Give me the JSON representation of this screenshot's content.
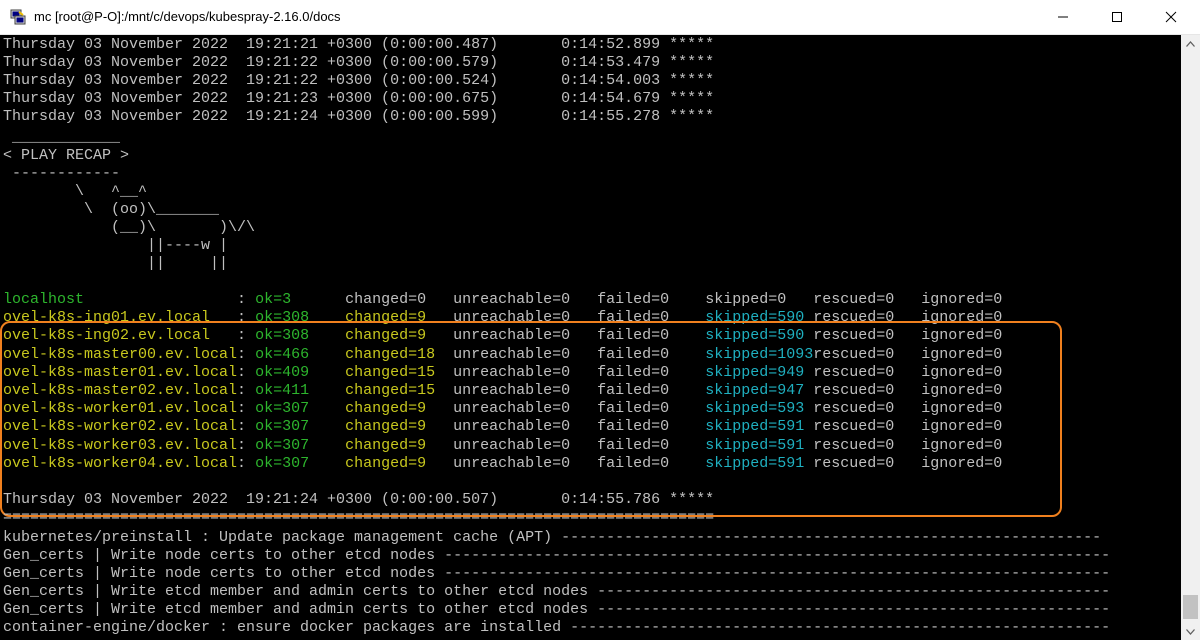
{
  "window": {
    "title": "mc [root@P-O]:/mnt/c/devops/kubespray-2.16.0/docs",
    "app_icon": "putty-terminal-icon",
    "buttons": {
      "minimize": "minimize-icon",
      "maximize": "maximize-icon",
      "close": "close-icon"
    }
  },
  "colors": {
    "background": "#000000",
    "text": "#c0c0c0",
    "ok": "#2db52d",
    "changed": "#c8c81e",
    "skipped": "#1fb0c0",
    "highlight": "#f0801e"
  },
  "terminal": {
    "timing_lines": [
      "Thursday 03 November 2022  19:21:21 +0300 (0:00:00.487)       0:14:52.899 *****",
      "Thursday 03 November 2022  19:21:22 +0300 (0:00:00.579)       0:14:53.479 *****",
      "Thursday 03 November 2022  19:21:22 +0300 (0:00:00.524)       0:14:54.003 *****",
      "Thursday 03 November 2022  19:21:23 +0300 (0:00:00.675)       0:14:54.679 *****",
      "Thursday 03 November 2022  19:21:24 +0300 (0:00:00.599)       0:14:55.278 *****"
    ],
    "cowsay": [
      " ____________",
      "< PLAY RECAP >",
      " ------------",
      "        \\   ^__^",
      "         \\  (oo)\\_______",
      "            (__)\\       )\\/\\",
      "                ||----w |",
      "                ||     ||"
    ],
    "recap": [
      {
        "host": "localhost                 ",
        "sep": ": ",
        "ok": "ok=3  ",
        "changed": "changed=0 ",
        "unreachable": "unreachable=0   ",
        "failed": "failed=0    ",
        "skipped": "skipped=0   ",
        "rescued": "rescued=0   ",
        "ignored": "ignored=0",
        "c_host": "c-green",
        "c_ok": "c-green",
        "c_changed": "c-gray",
        "c_skipped": "c-gray"
      },
      {
        "host": "ovel-k8s-ing01.ev.local   ",
        "sep": ": ",
        "ok": "ok=308",
        "changed": "changed=9 ",
        "unreachable": "unreachable=0   ",
        "failed": "failed=0    ",
        "skipped": "skipped=590 ",
        "rescued": "rescued=0   ",
        "ignored": "ignored=0",
        "c_host": "c-yellow",
        "c_ok": "c-green",
        "c_changed": "c-yellow",
        "c_skipped": "c-cyan"
      },
      {
        "host": "ovel-k8s-ing02.ev.local   ",
        "sep": ": ",
        "ok": "ok=308",
        "changed": "changed=9 ",
        "unreachable": "unreachable=0   ",
        "failed": "failed=0    ",
        "skipped": "skipped=590 ",
        "rescued": "rescued=0   ",
        "ignored": "ignored=0",
        "c_host": "c-yellow",
        "c_ok": "c-green",
        "c_changed": "c-yellow",
        "c_skipped": "c-cyan"
      },
      {
        "host": "ovel-k8s-master00.ev.local",
        "sep": ": ",
        "ok": "ok=466",
        "changed": "changed=18",
        "unreachable": "unreachable=0   ",
        "failed": "failed=0    ",
        "skipped": "skipped=1093",
        "rescued": "rescued=0   ",
        "ignored": "ignored=0",
        "c_host": "c-yellow",
        "c_ok": "c-green",
        "c_changed": "c-yellow",
        "c_skipped": "c-cyan"
      },
      {
        "host": "ovel-k8s-master01.ev.local",
        "sep": ": ",
        "ok": "ok=409",
        "changed": "changed=15",
        "unreachable": "unreachable=0   ",
        "failed": "failed=0    ",
        "skipped": "skipped=949 ",
        "rescued": "rescued=0   ",
        "ignored": "ignored=0",
        "c_host": "c-yellow",
        "c_ok": "c-green",
        "c_changed": "c-yellow",
        "c_skipped": "c-cyan"
      },
      {
        "host": "ovel-k8s-master02.ev.local",
        "sep": ": ",
        "ok": "ok=411",
        "changed": "changed=15",
        "unreachable": "unreachable=0   ",
        "failed": "failed=0    ",
        "skipped": "skipped=947 ",
        "rescued": "rescued=0   ",
        "ignored": "ignored=0",
        "c_host": "c-yellow",
        "c_ok": "c-green",
        "c_changed": "c-yellow",
        "c_skipped": "c-cyan"
      },
      {
        "host": "ovel-k8s-worker01.ev.local",
        "sep": ": ",
        "ok": "ok=307",
        "changed": "changed=9 ",
        "unreachable": "unreachable=0   ",
        "failed": "failed=0    ",
        "skipped": "skipped=593 ",
        "rescued": "rescued=0   ",
        "ignored": "ignored=0",
        "c_host": "c-yellow",
        "c_ok": "c-green",
        "c_changed": "c-yellow",
        "c_skipped": "c-cyan"
      },
      {
        "host": "ovel-k8s-worker02.ev.local",
        "sep": ": ",
        "ok": "ok=307",
        "changed": "changed=9 ",
        "unreachable": "unreachable=0   ",
        "failed": "failed=0    ",
        "skipped": "skipped=591 ",
        "rescued": "rescued=0   ",
        "ignored": "ignored=0",
        "c_host": "c-yellow",
        "c_ok": "c-green",
        "c_changed": "c-yellow",
        "c_skipped": "c-cyan"
      },
      {
        "host": "ovel-k8s-worker03.ev.local",
        "sep": ": ",
        "ok": "ok=307",
        "changed": "changed=9 ",
        "unreachable": "unreachable=0   ",
        "failed": "failed=0    ",
        "skipped": "skipped=591 ",
        "rescued": "rescued=0   ",
        "ignored": "ignored=0",
        "c_host": "c-yellow",
        "c_ok": "c-green",
        "c_changed": "c-yellow",
        "c_skipped": "c-cyan"
      },
      {
        "host": "ovel-k8s-worker04.ev.local",
        "sep": ": ",
        "ok": "ok=307",
        "changed": "changed=9 ",
        "unreachable": "unreachable=0   ",
        "failed": "failed=0    ",
        "skipped": "skipped=591 ",
        "rescued": "rescued=0   ",
        "ignored": "ignored=0",
        "c_host": "c-yellow",
        "c_ok": "c-green",
        "c_changed": "c-yellow",
        "c_skipped": "c-cyan"
      }
    ],
    "final_timing": "Thursday 03 November 2022  19:21:24 +0300 (0:00:00.507)       0:14:55.786 *****",
    "separator": "===============================================================================",
    "tasks": [
      "kubernetes/preinstall : Update package management cache (APT) ------------------------------------------------------------",
      "Gen_certs | Write node certs to other etcd nodes --------------------------------------------------------------------------",
      "Gen_certs | Write node certs to other etcd nodes --------------------------------------------------------------------------",
      "Gen_certs | Write etcd member and admin certs to other etcd nodes ---------------------------------------------------------",
      "Gen_certs | Write etcd member and admin certs to other etcd nodes ---------------------------------------------------------",
      "container-engine/docker : ensure docker packages are installed ------------------------------------------------------------"
    ]
  }
}
